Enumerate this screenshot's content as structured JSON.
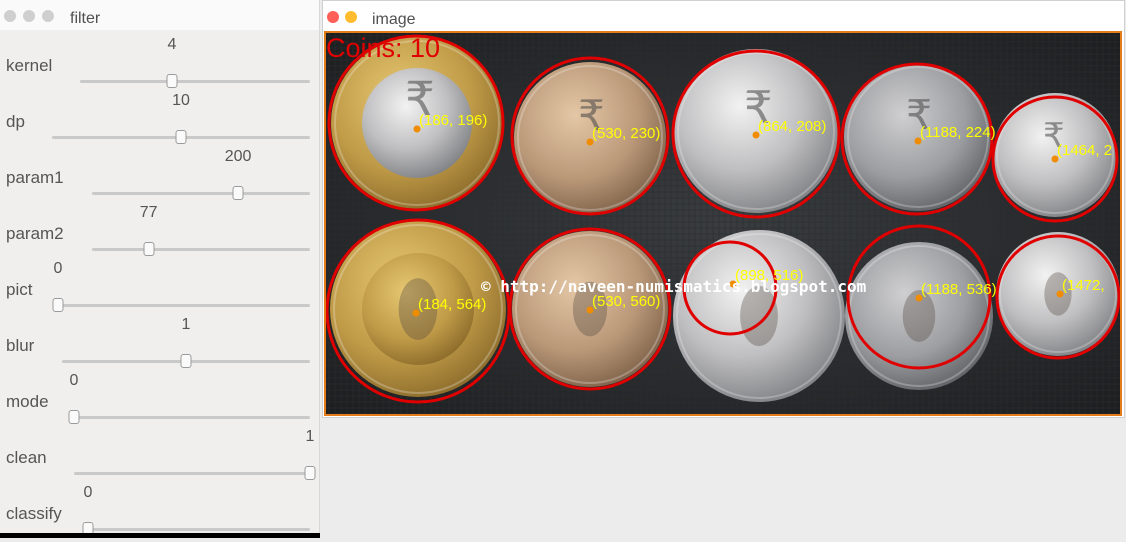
{
  "filter_window": {
    "title": "filter",
    "sliders": [
      {
        "label": "kernel",
        "value": "4",
        "fraction": 0.4
      },
      {
        "label": "dp",
        "value": "10",
        "fraction": 0.5
      },
      {
        "label": "param1",
        "value": "200",
        "fraction": 0.67
      },
      {
        "label": "param2",
        "value": "77",
        "fraction": 0.26
      },
      {
        "label": "pict",
        "value": "0",
        "fraction": 0.0
      },
      {
        "label": "blur",
        "value": "1",
        "fraction": 0.5
      },
      {
        "label": "mode",
        "value": "0",
        "fraction": 0.0
      },
      {
        "label": "clean",
        "value": "1",
        "fraction": 1.0
      },
      {
        "label": "classify",
        "value": "0",
        "fraction": 0.0
      }
    ]
  },
  "image_window": {
    "title": "image",
    "coin_count_label": "Coins: 10",
    "watermark": "© http://naveen-numismatics.blogspot.com",
    "detections": [
      {
        "label": "(186, 196)"
      },
      {
        "label": "(530, 230)"
      },
      {
        "label": "(864, 208)"
      },
      {
        "label": "(1188, 224)"
      },
      {
        "label": "(1464, 2"
      },
      {
        "label": "(184, 564)"
      },
      {
        "label": "(530, 560)"
      },
      {
        "label": "(898, 516)"
      },
      {
        "label": "(1188, 536)"
      },
      {
        "label": "(1472,"
      }
    ]
  },
  "colors": {
    "detection_circle": "#e00000",
    "center_dot": "#f08c00",
    "coordinate_text": "#ffff00",
    "image_border": "#e57c1a",
    "close_button": "#ff5f57",
    "minimize_button": "#febc2e"
  }
}
